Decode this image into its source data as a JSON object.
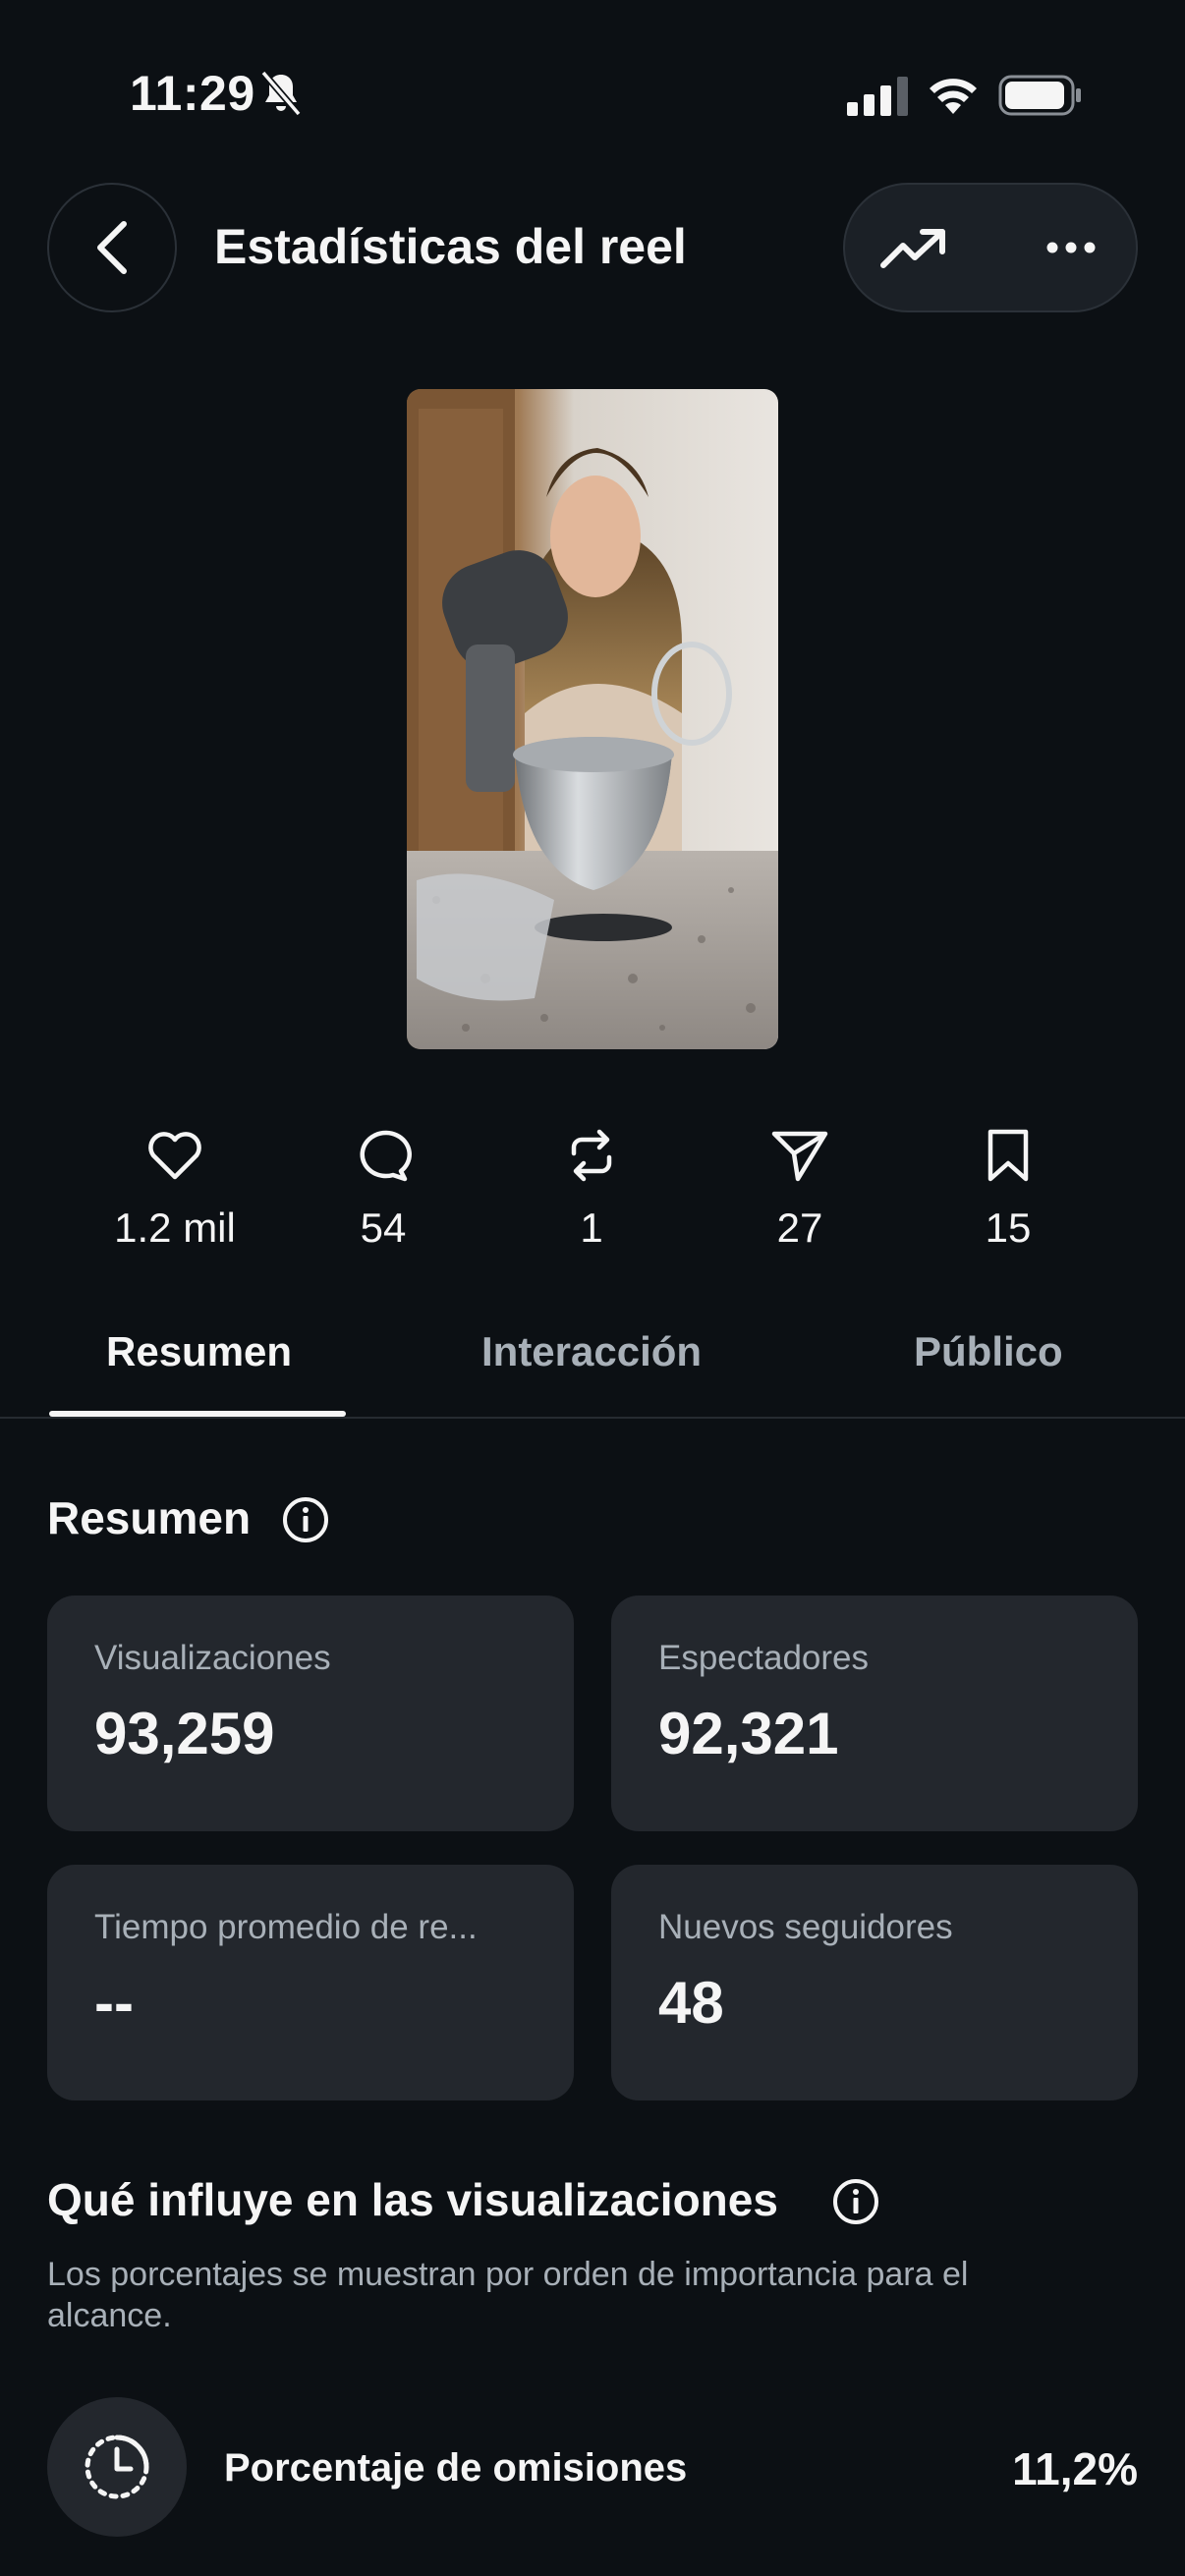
{
  "status_bar": {
    "time": "11:29"
  },
  "header": {
    "title": "Estadísticas del reel"
  },
  "engagement": [
    {
      "icon": "heart-icon",
      "count": "1.2 mil"
    },
    {
      "icon": "comment-icon",
      "count": "54"
    },
    {
      "icon": "repost-icon",
      "count": "1"
    },
    {
      "icon": "share-icon",
      "count": "27"
    },
    {
      "icon": "bookmark-icon",
      "count": "15"
    }
  ],
  "tabs": [
    {
      "label": "Resumen",
      "active": true
    },
    {
      "label": "Interacción",
      "active": false
    },
    {
      "label": "Público",
      "active": false
    }
  ],
  "summary": {
    "title": "Resumen",
    "cards": [
      {
        "label": "Visualizaciones",
        "value": "93,259"
      },
      {
        "label": "Espectadores",
        "value": "92,321"
      },
      {
        "label": "Tiempo promedio de re...",
        "value": "--"
      },
      {
        "label": "Nuevos seguidores",
        "value": "48"
      }
    ]
  },
  "influence": {
    "title": "Qué influye en las visualizaciones",
    "subtext": "Los porcentajes se muestran por orden de importancia para el alcance.",
    "factors": [
      {
        "icon": "timer-icon",
        "label": "Porcentaje de omisiones",
        "value": "11,2%"
      }
    ]
  },
  "colors": {
    "background": "#0c1014",
    "card": "#23272d",
    "text_primary": "#f5f5f5",
    "text_secondary": "#a8b0b8"
  }
}
